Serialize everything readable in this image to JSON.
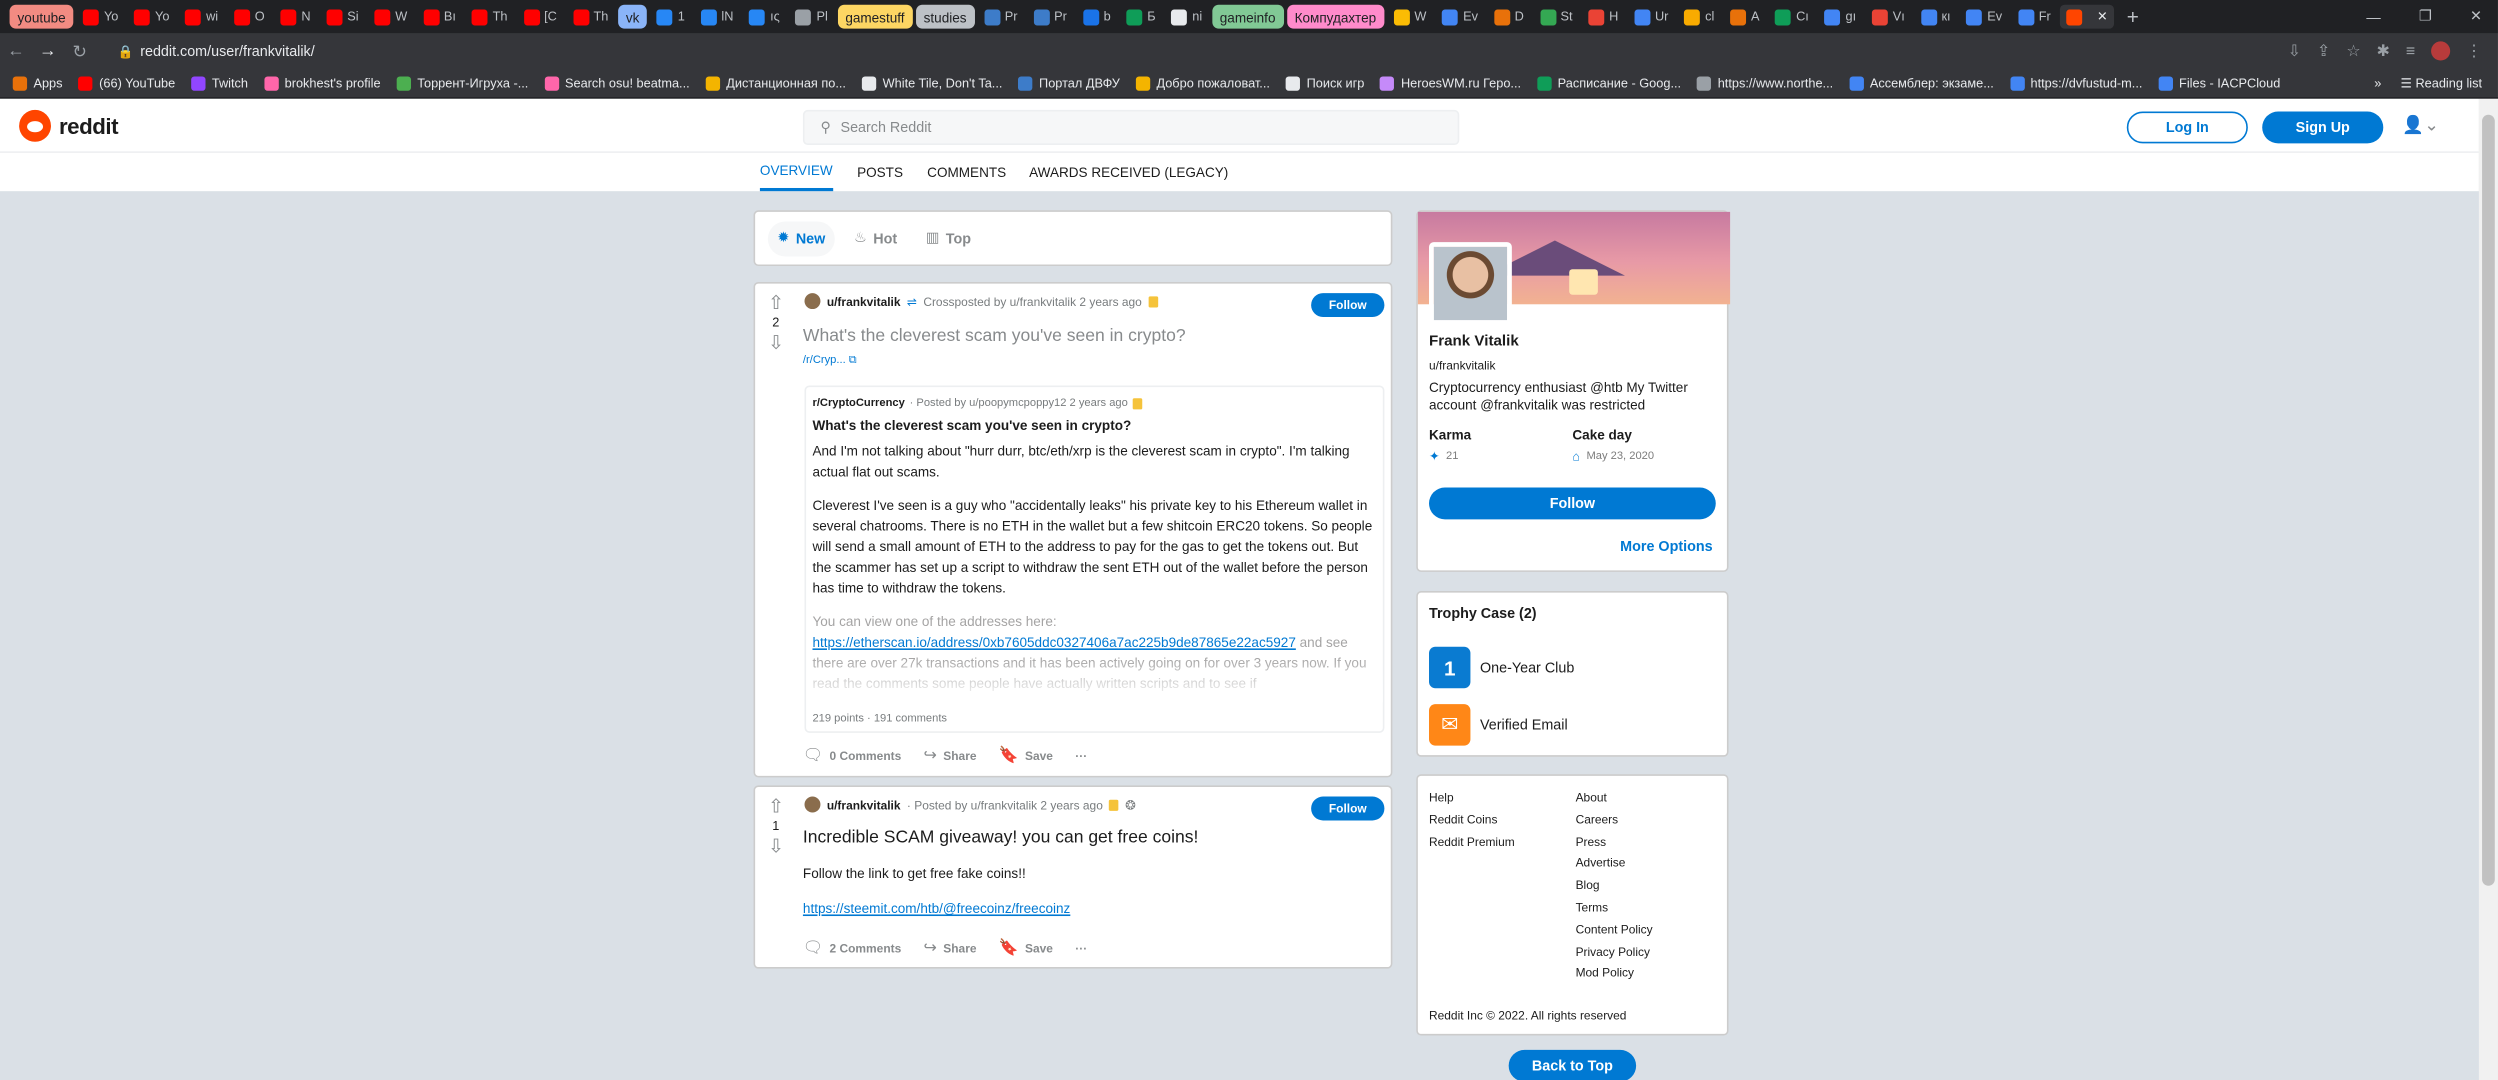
{
  "browser": {
    "tabs": [
      {
        "label": "youtube",
        "type": "group",
        "color": "#f28b82"
      },
      {
        "label": "Yo",
        "color": "#ff0000"
      },
      {
        "label": "Yo",
        "color": "#ff0000"
      },
      {
        "label": "wi",
        "color": "#ff0000"
      },
      {
        "label": "O",
        "color": "#ff0000"
      },
      {
        "label": "N",
        "color": "#ff0000"
      },
      {
        "label": "Si",
        "color": "#ff0000"
      },
      {
        "label": "W",
        "color": "#ff0000"
      },
      {
        "label": "Bı",
        "color": "#ff0000"
      },
      {
        "label": "Th",
        "color": "#ff0000"
      },
      {
        "label": "[C",
        "color": "#ff0000"
      },
      {
        "label": "Th",
        "color": "#ff0000"
      },
      {
        "label": "vk",
        "type": "group",
        "color": "#8ab4f8"
      },
      {
        "label": "1",
        "color": "#2787f5"
      },
      {
        "label": "lN",
        "color": "#2787f5"
      },
      {
        "label": "ıς",
        "color": "#2787f5"
      },
      {
        "label": "Pl",
        "color": "#9aa0a6"
      },
      {
        "label": "gamestuff",
        "type": "group",
        "color": "#fdd663"
      },
      {
        "label": "studies",
        "type": "group",
        "color": "#bdc1c6"
      },
      {
        "label": "Pr",
        "color": "#3d7cc9"
      },
      {
        "label": "Pr",
        "color": "#3d7cc9"
      },
      {
        "label": "b",
        "color": "#1a73e8"
      },
      {
        "label": "Б",
        "color": "#0f9d58"
      },
      {
        "label": "ni",
        "color": "#e8eaed"
      },
      {
        "label": "gameinfo",
        "type": "group",
        "color": "#81c995"
      },
      {
        "label": "Компудахтер",
        "type": "group",
        "color": "#ff8bcb"
      },
      {
        "label": "W",
        "color": "#fbbc04"
      },
      {
        "label": "Ev",
        "color": "#4285f4"
      },
      {
        "label": "D",
        "color": "#e8710a"
      },
      {
        "label": "St",
        "color": "#34a853"
      },
      {
        "label": "H",
        "color": "#ea4335"
      },
      {
        "label": "Ur",
        "color": "#4285f4"
      },
      {
        "label": "cl",
        "color": "#f9ab00"
      },
      {
        "label": "A",
        "color": "#e8710a"
      },
      {
        "label": "Cı",
        "color": "#0f9d58"
      },
      {
        "label": "gı",
        "color": "#4285f4"
      },
      {
        "label": "Vı",
        "color": "#ea4335"
      },
      {
        "label": "кı",
        "color": "#4285f4"
      },
      {
        "label": "Ev",
        "color": "#4285f4"
      },
      {
        "label": "Fr",
        "color": "#4285f4"
      },
      {
        "label": "",
        "type": "active",
        "color": "#ff4500"
      }
    ],
    "url": "reddit.com/user/frankvitalik/",
    "bookmarks": [
      {
        "label": "Apps",
        "color": "#e8710a"
      },
      {
        "label": "(66) YouTube",
        "color": "#ff0000"
      },
      {
        "label": "Twitch",
        "color": "#9146ff"
      },
      {
        "label": "brokhest's profile",
        "color": "#ff66aa"
      },
      {
        "label": "Торрент-Игруха -...",
        "color": "#4caf50"
      },
      {
        "label": "Search osu! beatma...",
        "color": "#ff66aa"
      },
      {
        "label": "Дистанционная по...",
        "color": "#f4b400"
      },
      {
        "label": "White Tile, Don't Ta...",
        "color": "#e8eaed"
      },
      {
        "label": "Портал ДВФУ",
        "color": "#3d7cc9"
      },
      {
        "label": "Добро пожаловат...",
        "color": "#f4b400"
      },
      {
        "label": "Поиск игр",
        "color": "#e8eaed"
      },
      {
        "label": "HeroesWM.ru Геро...",
        "color": "#c58af9"
      },
      {
        "label": "Расписание - Goog...",
        "color": "#0f9d58"
      },
      {
        "label": "https://www.northe...",
        "color": "#9aa0a6"
      },
      {
        "label": "Ассемблер: экзаме...",
        "color": "#4285f4"
      },
      {
        "label": "https://dvfustud-m...",
        "color": "#4285f4"
      },
      {
        "label": "Files - IACPCloud",
        "color": "#4285f4"
      }
    ],
    "reading_list": "Reading list"
  },
  "header": {
    "logo_text": "reddit",
    "search_placeholder": "Search Reddit",
    "login_label": "Log In",
    "signup_label": "Sign Up"
  },
  "profile_nav": [
    "OVERVIEW",
    "POSTS",
    "COMMENTS",
    "AWARDS RECEIVED (LEGACY)"
  ],
  "sort": {
    "new": "New",
    "hot": "Hot",
    "top": "Top"
  },
  "posts": [
    {
      "score": "2",
      "user": "u/frankvitalik",
      "meta": "Crossposted by u/frankvitalik 2 years ago",
      "title": "What's the cleverest scam you've seen in crypto?",
      "link": "/r/Cryp...",
      "follow": "Follow",
      "crosspost": {
        "sub": "r/CryptoCurrency",
        "meta": "· Posted by u/poopymcpoppy12 2 years ago",
        "title": "What's the cleverest scam you've seen in crypto?",
        "p1": "And I'm not talking about \"hurr durr, btc/eth/xrp is the cleverest scam in crypto\". I'm talking actual flat out scams.",
        "p2": "Cleverest I've seen is a guy who \"accidentally leaks\" his private key to his Ethereum wallet in several chatrooms. There is no ETH in the wallet but a few shitcoin ERC20 tokens. So people will send a small amount of ETH to the address to pay for the gas to get the tokens out. But the scammer has set up a script to withdraw the sent ETH out of the wallet before the person has time to withdraw the tokens.",
        "p3a": "You can view one of the addresses here:",
        "p3link": "https://etherscan.io/address/0xb7605ddc0327406a7ac225b9de87865e22ac5927",
        "p3b": "and see there are over 27k transactions and it has been actively going on for over 3 years now. If you read the comments some people have actually written scripts and to see if",
        "stats": "219 points · 191 comments"
      },
      "comments": "0 Comments",
      "share": "Share",
      "save": "Save"
    },
    {
      "score": "1",
      "user": "u/frankvitalik",
      "meta": "· Posted by u/frankvitalik 2 years ago",
      "title": "Incredible SCAM giveaway! you can get free coins!",
      "body": "Follow the link to get free fake coins!!",
      "link": "https://steemit.com/htb/@freecoinz/freecoinz",
      "follow": "Follow",
      "comments": "2 Comments",
      "share": "Share",
      "save": "Save"
    }
  ],
  "profile": {
    "name": "Frank Vitalik",
    "username": "u/frankvitalik",
    "bio": "Cryptocurrency enthusiast @htb My Twitter account @frankvitalik was restricted",
    "karma_label": "Karma",
    "karma_value": "21",
    "cakeday_label": "Cake day",
    "cakeday_value": "May 23, 2020",
    "follow": "Follow",
    "more_options": "More Options"
  },
  "trophies": {
    "title": "Trophy Case (2)",
    "items": [
      "One-Year Club",
      "Verified Email"
    ]
  },
  "footer": {
    "col1": [
      "Help",
      "Reddit Coins",
      "Reddit Premium"
    ],
    "col2": [
      "About",
      "Careers",
      "Press",
      "Advertise",
      "Blog",
      "Terms",
      "Content Policy",
      "Privacy Policy",
      "Mod Policy"
    ],
    "copyright": "Reddit Inc © 2022. All rights reserved"
  },
  "back_to_top": "Back to Top"
}
